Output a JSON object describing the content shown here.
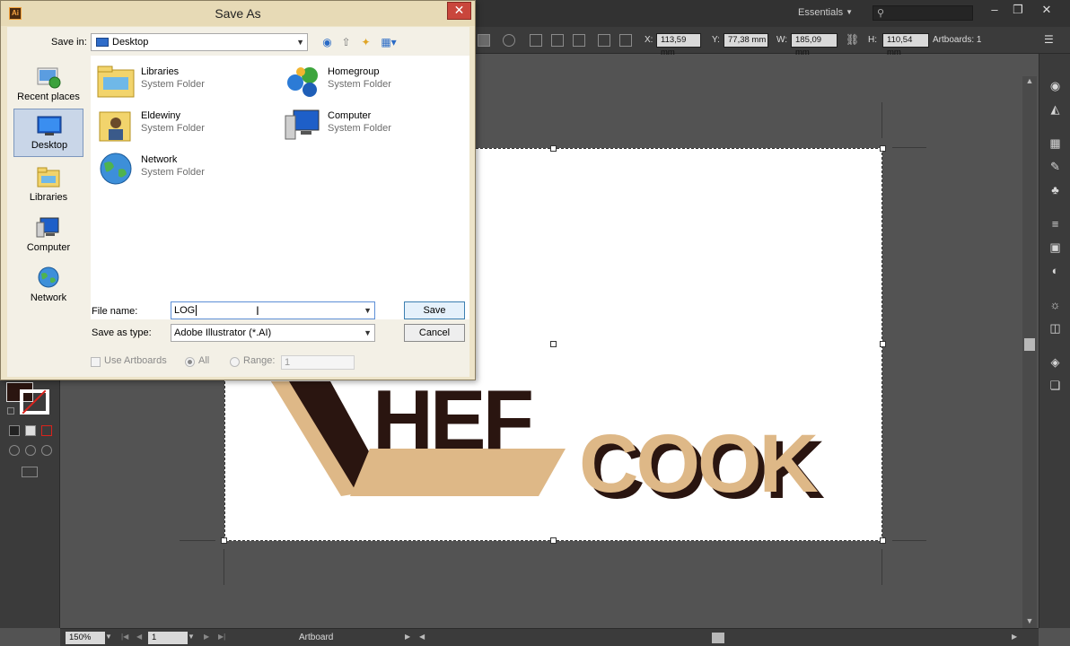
{
  "app": {
    "workspace": "Essentials",
    "control_bar": {
      "x_label": "X:",
      "x_value": "113,59 mm",
      "y_label": "Y:",
      "y_value": "77,38 mm",
      "w_label": "W:",
      "w_value": "185,09 mm",
      "h_label": "H:",
      "h_value": "110,54 mm",
      "artboards_label": "Artboards: 1"
    },
    "status": {
      "zoom": "150%",
      "page": "1",
      "mode": "Artboard"
    },
    "colors": {
      "fill": "#2a1510",
      "accent": "#deb887"
    }
  },
  "artwork": {
    "word1": "HEF",
    "word2": "COOK",
    "dark_color": "#2a1510",
    "tan_color": "#deb887"
  },
  "dialog": {
    "title": "Save As",
    "app_badge": "Ai",
    "save_in_label": "Save in:",
    "save_in_value": "Desktop",
    "places": [
      {
        "label": "Recent places"
      },
      {
        "label": "Desktop"
      },
      {
        "label": "Libraries"
      },
      {
        "label": "Computer"
      },
      {
        "label": "Network"
      }
    ],
    "files": [
      {
        "name": "Libraries",
        "type": "System Folder"
      },
      {
        "name": "Homegroup",
        "type": "System Folder"
      },
      {
        "name": "Eldewiny",
        "type": "System Folder"
      },
      {
        "name": "Computer",
        "type": "System Folder"
      },
      {
        "name": "Network",
        "type": "System Folder"
      }
    ],
    "file_name_label": "File name:",
    "file_name_value": "LOG",
    "save_type_label": "Save as type:",
    "save_type_value": "Adobe Illustrator (*.AI)",
    "save_button": "Save",
    "cancel_button": "Cancel",
    "use_artboards_label": "Use Artboards",
    "all_label": "All",
    "range_label": "Range:",
    "range_value": "1"
  }
}
